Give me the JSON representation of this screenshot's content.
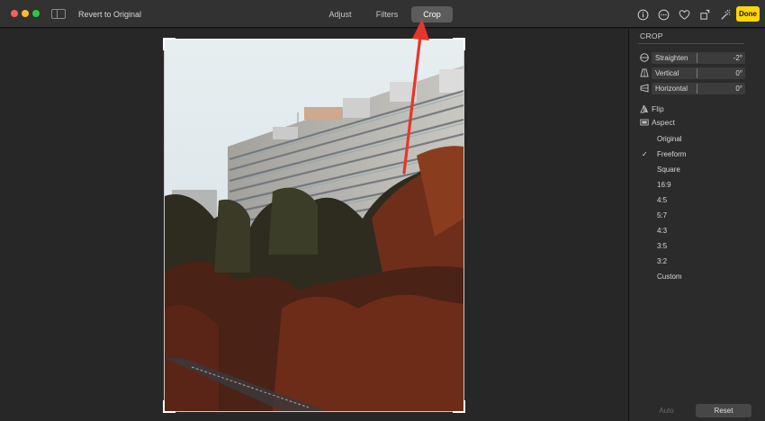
{
  "toolbar": {
    "revert_label": "Revert to Original",
    "tabs": [
      {
        "label": "Adjust",
        "active": false
      },
      {
        "label": "Filters",
        "active": false
      },
      {
        "label": "Crop",
        "active": true
      }
    ],
    "icons": [
      "info-icon",
      "more-icon",
      "heart-icon",
      "rotate-icon",
      "magic-wand-icon"
    ],
    "done_label": "Done",
    "accent_color": "#ffd60a"
  },
  "panel": {
    "title": "CROP",
    "sliders": [
      {
        "label": "Straighten",
        "value": "-2°",
        "icon": "straighten-icon"
      },
      {
        "label": "Vertical",
        "value": "0°",
        "icon": "vertical-perspective-icon"
      },
      {
        "label": "Horizontal",
        "value": "0°",
        "icon": "horizontal-perspective-icon"
      }
    ],
    "flip_label": "Flip",
    "aspect_label": "Aspect",
    "aspect_options": [
      {
        "label": "Original",
        "selected": false
      },
      {
        "label": "Freeform",
        "selected": true
      },
      {
        "label": "Square",
        "selected": false
      },
      {
        "label": "16:9",
        "selected": false
      },
      {
        "label": "4:5",
        "selected": false
      },
      {
        "label": "5:7",
        "selected": false
      },
      {
        "label": "4:3",
        "selected": false
      },
      {
        "label": "3:5",
        "selected": false
      },
      {
        "label": "3:2",
        "selected": false
      },
      {
        "label": "Custom",
        "selected": false
      }
    ],
    "check_mark": "✓",
    "auto_label": "Auto",
    "reset_label": "Reset"
  },
  "annotation": {
    "color": "#e8352b"
  }
}
